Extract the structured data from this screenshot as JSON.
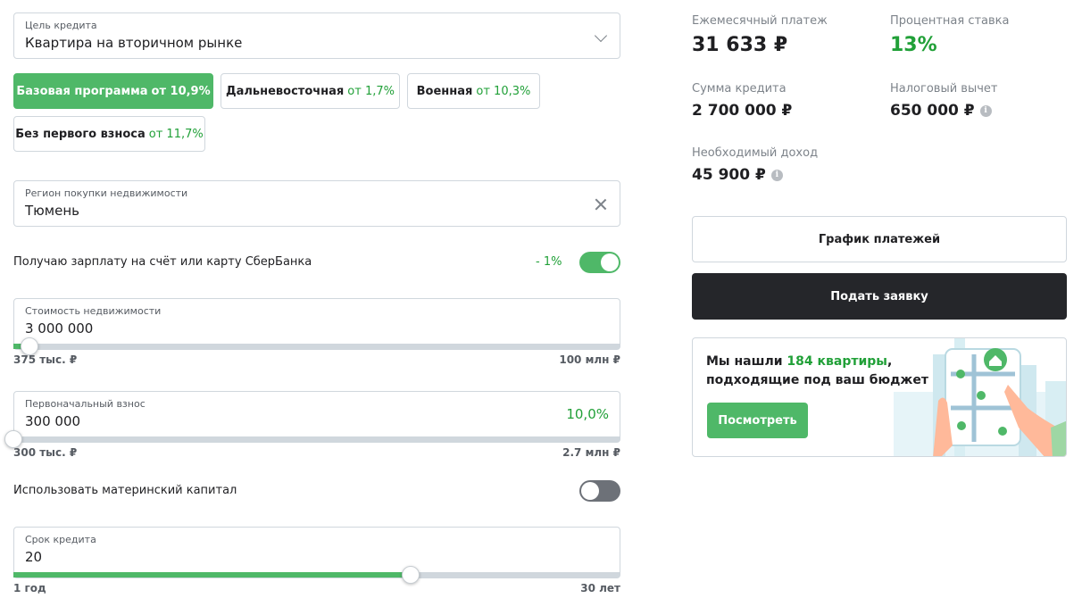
{
  "loan_purpose": {
    "label": "Цель кредита",
    "value": "Квартира на вторичном рынке"
  },
  "programs": [
    {
      "name": "Базовая программа",
      "rate": "от 10,9%",
      "active": true
    },
    {
      "name": "Дальневосточная",
      "rate": "от 1,7%",
      "active": false
    },
    {
      "name": "Военная",
      "rate": "от 10,3%",
      "active": false
    },
    {
      "name": "Без первого взноса",
      "rate": "от 11,7%",
      "active": false
    }
  ],
  "region": {
    "label": "Регион покупки недвижимости",
    "value": "Тюмень"
  },
  "salary_option": {
    "label": "Получаю зарплату на счёт или карту СберБанка",
    "discount": "- 1%",
    "enabled": true
  },
  "property_cost": {
    "label": "Стоимость недвижимости",
    "value": "3 000 000",
    "min_label": "375 тыс. ₽",
    "max_label": "100 млн ₽",
    "slider_fraction": 0.027
  },
  "down_payment": {
    "label": "Первоначальный взнос",
    "value": "300 000",
    "percent": "10,0%",
    "min_label": "300 тыс. ₽",
    "max_label": "2.7 млн ₽",
    "slider_fraction": 0.0
  },
  "maternity_capital": {
    "label": "Использовать материнский капитал",
    "enabled": false
  },
  "loan_term": {
    "label": "Срок кредита",
    "value": "20",
    "min_label": "1 год",
    "max_label": "30 лет",
    "slider_fraction": 0.655
  },
  "summary": {
    "monthly_payment_label": "Ежемесячный платеж",
    "monthly_payment_value": "31 633 ₽",
    "rate_label": "Процентная ставка",
    "rate_value": "13%",
    "loan_amount_label": "Сумма кредита",
    "loan_amount_value": "2 700 000 ₽",
    "tax_deduction_label": "Налоговый вычет",
    "tax_deduction_value": "650 000 ₽",
    "required_income_label": "Необходимый доход",
    "required_income_value": "45 900 ₽"
  },
  "buttons": {
    "schedule": "График платежей",
    "apply": "Подать заявку"
  },
  "promo": {
    "text_before": "Мы нашли ",
    "count_text": "184 квартиры",
    "text_after": ",",
    "line2": "подходящие под ваш бюджет",
    "button": "Посмотреть"
  },
  "colors": {
    "accent": "#4fb868",
    "accent_text": "#21a038",
    "dark_button": "#25262a",
    "border": "#d0d7dd"
  }
}
